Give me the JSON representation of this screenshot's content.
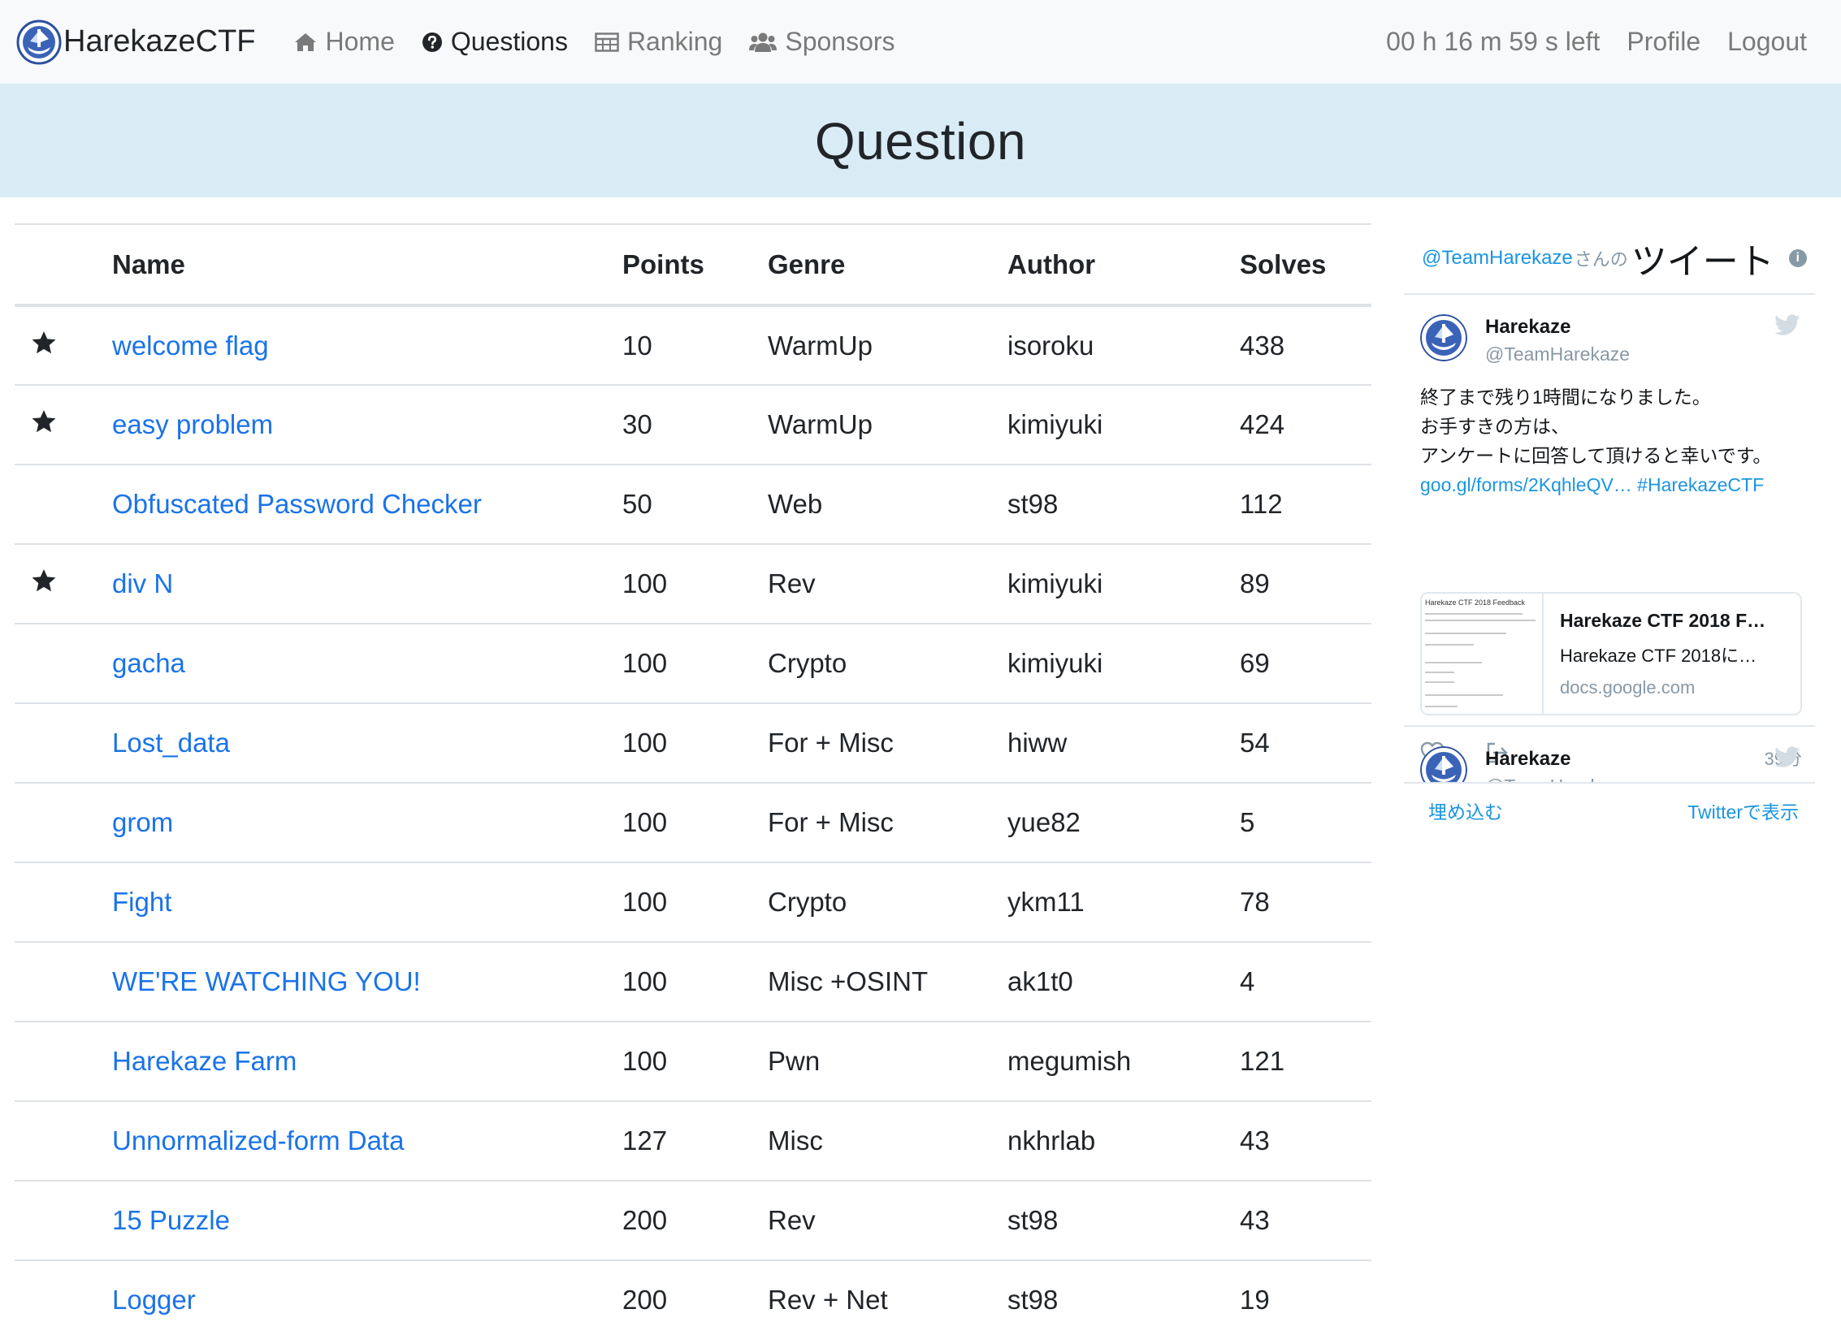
{
  "navbar": {
    "brand": "HarekazeCTF",
    "items": [
      {
        "label": "Home",
        "icon": "home-icon",
        "active": false
      },
      {
        "label": "Questions",
        "icon": "question-circle-icon",
        "active": true
      },
      {
        "label": "Ranking",
        "icon": "table-icon",
        "active": false
      },
      {
        "label": "Sponsors",
        "icon": "users-icon",
        "active": false
      }
    ],
    "timer": "00 h 16 m 59 s left",
    "profile": "Profile",
    "logout": "Logout"
  },
  "page": {
    "title": "Question"
  },
  "table": {
    "headers": {
      "star": "",
      "name": "Name",
      "points": "Points",
      "genre": "Genre",
      "author": "Author",
      "solves": "Solves"
    },
    "rows": [
      {
        "starred": true,
        "name": "welcome flag",
        "points": "10",
        "genre": "WarmUp",
        "author": "isoroku",
        "solves": "438"
      },
      {
        "starred": true,
        "name": "easy problem",
        "points": "30",
        "genre": "WarmUp",
        "author": "kimiyuki",
        "solves": "424"
      },
      {
        "starred": false,
        "name": "Obfuscated Password Checker",
        "points": "50",
        "genre": "Web",
        "author": "st98",
        "solves": "112"
      },
      {
        "starred": true,
        "name": "div N",
        "points": "100",
        "genre": "Rev",
        "author": "kimiyuki",
        "solves": "89"
      },
      {
        "starred": false,
        "name": "gacha",
        "points": "100",
        "genre": "Crypto",
        "author": "kimiyuki",
        "solves": "69"
      },
      {
        "starred": false,
        "name": "Lost_data",
        "points": "100",
        "genre": "For + Misc",
        "author": "hiww",
        "solves": "54"
      },
      {
        "starred": false,
        "name": "grom",
        "points": "100",
        "genre": "For + Misc",
        "author": "yue82",
        "solves": "5"
      },
      {
        "starred": false,
        "name": "Fight",
        "points": "100",
        "genre": "Crypto",
        "author": "ykm11",
        "solves": "78"
      },
      {
        "starred": false,
        "name": "WE'RE WATCHING YOU!",
        "points": "100",
        "genre": "Misc +OSINT",
        "author": "ak1t0",
        "solves": "4"
      },
      {
        "starred": false,
        "name": "Harekaze Farm",
        "points": "100",
        "genre": "Pwn",
        "author": "megumish",
        "solves": "121"
      },
      {
        "starred": false,
        "name": "Unnormalized-form Data",
        "points": "127",
        "genre": "Misc",
        "author": "nkhrlab",
        "solves": "43"
      },
      {
        "starred": false,
        "name": "15 Puzzle",
        "points": "200",
        "genre": "Rev",
        "author": "st98",
        "solves": "43"
      },
      {
        "starred": false,
        "name": "Logger",
        "points": "200",
        "genre": "Rev + Net",
        "author": "st98",
        "solves": "19"
      }
    ]
  },
  "twitter": {
    "header_handle": "@TeamHarekaze",
    "header_san": "さんの",
    "header_tweets": "ツイート",
    "header_info": "i",
    "tweet1": {
      "name": "Harekaze",
      "handle": "@TeamHarekaze",
      "lines": [
        "終了まで残り1時間になりました。",
        "お手すきの方は、",
        "アンケートに回答して頂けると幸いです。"
      ],
      "link_text": "goo.gl/forms/2KqhleQV… #HarekazeCTF",
      "card": {
        "thumb_title": "Harekaze CTF 2018 Feedback",
        "title": "Harekaze CTF 2018 F…",
        "description": "Harekaze CTF 2018に…",
        "url": "docs.google.com"
      },
      "time": "39分"
    },
    "tweet2": {
      "name": "Harekaze",
      "handle": "@TeamHarekaze"
    },
    "footer_embed": "埋め込む",
    "footer_view": "Twitterで表示"
  }
}
